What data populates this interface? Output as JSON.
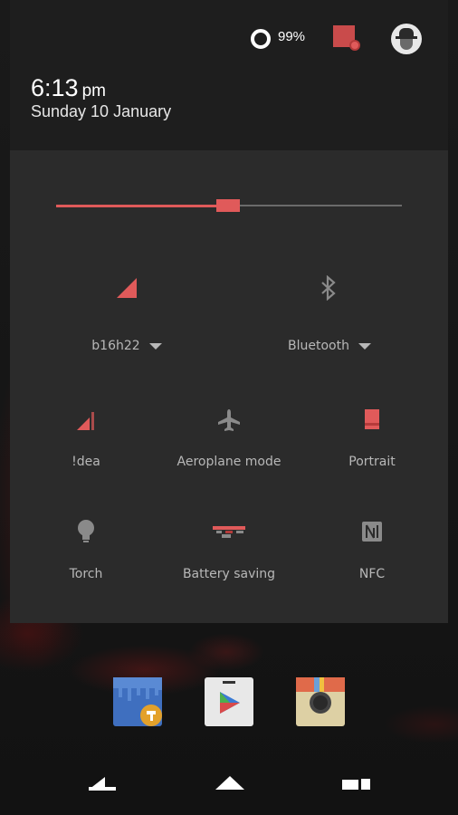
{
  "status": {
    "battery_percent": "99%"
  },
  "clock": {
    "time": "6:13",
    "ampm": "pm",
    "date": "Sunday 10 January"
  },
  "brightness": {
    "level": 0.5
  },
  "tiles": {
    "wifi": {
      "label": "b16h22",
      "icon": "wifi-icon"
    },
    "bluetooth": {
      "label": "Bluetooth",
      "icon": "bluetooth-icon"
    },
    "mobile_data": {
      "label": "!dea",
      "icon": "signal-icon"
    },
    "aeroplane": {
      "label": "Aeroplane mode",
      "icon": "airplane-icon"
    },
    "rotation": {
      "label": "Portrait",
      "icon": "portrait-icon"
    },
    "torch": {
      "label": "Torch",
      "icon": "lightbulb-icon"
    },
    "battery_saving": {
      "label": "Battery saving",
      "icon": "battery-saver-icon"
    },
    "nfc": {
      "label": "NFC",
      "icon": "nfc-icon"
    }
  },
  "dock": [
    "sketch-app-icon",
    "play-store-icon",
    "camera-app-icon"
  ],
  "nav": [
    "back-button",
    "home-button",
    "recents-button"
  ],
  "colors": {
    "accent": "#e05a5a",
    "panel": "#2b2b2b",
    "header": "#1e1e1e"
  }
}
